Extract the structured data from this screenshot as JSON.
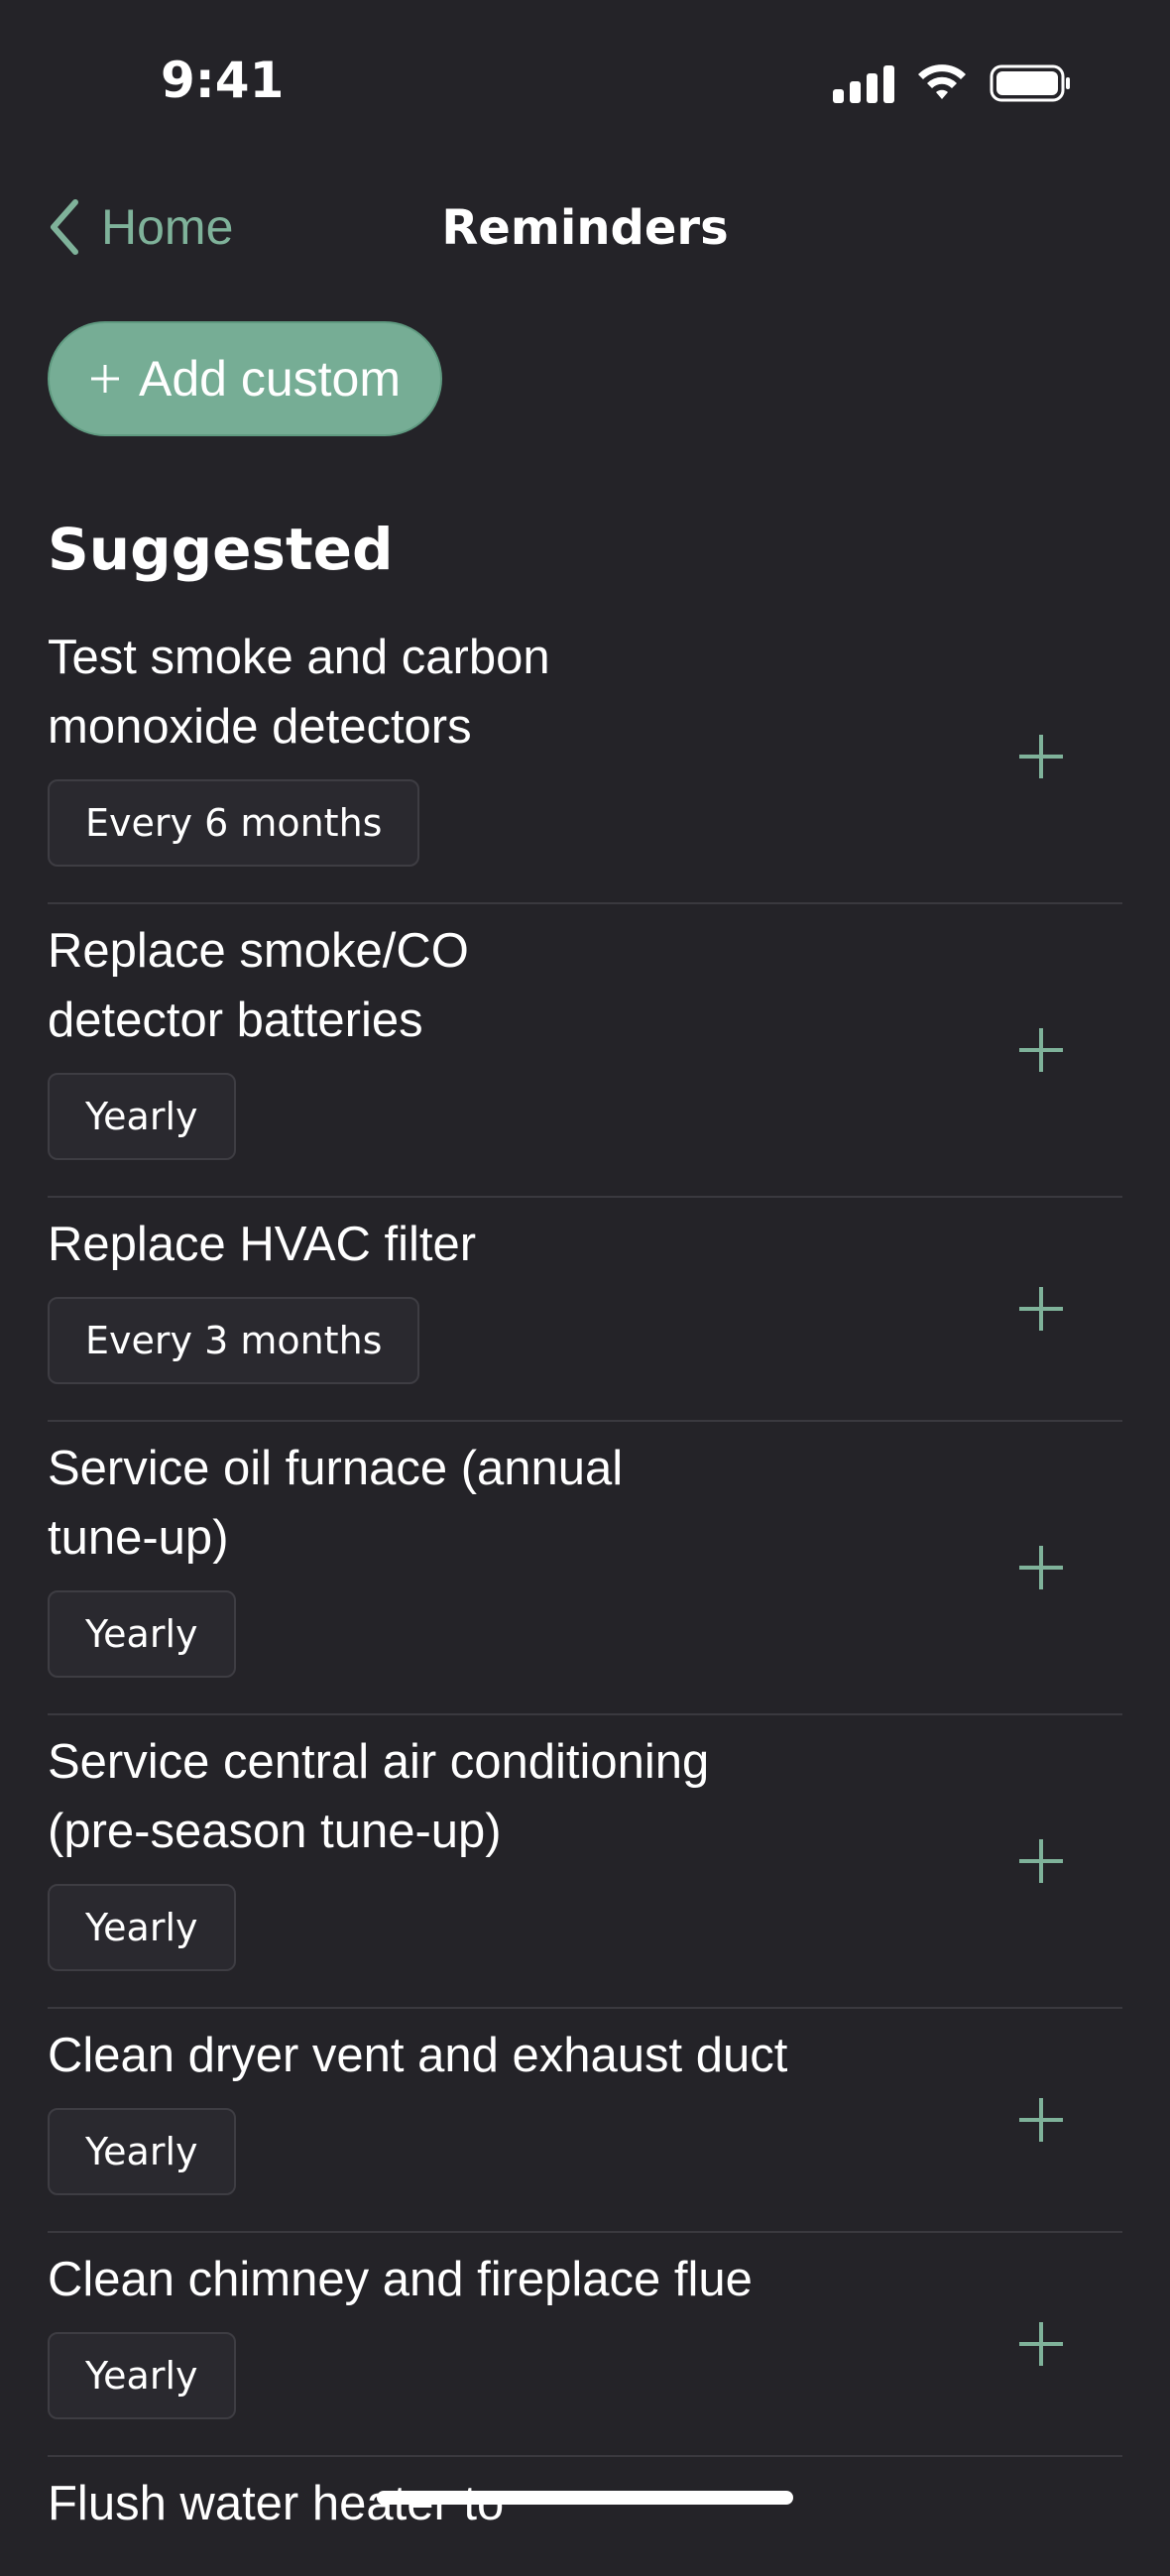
{
  "status_bar": {
    "time": "9:41",
    "icons": [
      "cellular-signal-icon",
      "wifi-icon",
      "battery-icon"
    ]
  },
  "nav": {
    "back_label": "Home",
    "title": "Reminders"
  },
  "add_custom": {
    "label": "Add custom"
  },
  "section": {
    "title": "Suggested"
  },
  "items": [
    {
      "title": "Test smoke and carbon monoxide detectors",
      "frequency": "Every 6 months"
    },
    {
      "title": "Replace smoke/CO detector batteries",
      "frequency": "Yearly"
    },
    {
      "title": "Replace HVAC filter",
      "frequency": "Every 3 months"
    },
    {
      "title": "Service oil furnace (annual tune-up)",
      "frequency": "Yearly"
    },
    {
      "title": "Service central air conditioning (pre-season tune-up)",
      "frequency": "Yearly"
    },
    {
      "title": "Clean dryer vent and exhaust duct",
      "frequency": "Yearly"
    },
    {
      "title": "Clean chimney and fireplace flue",
      "frequency": "Yearly"
    },
    {
      "title": "Flush water heater to",
      "frequency": ""
    }
  ],
  "colors": {
    "background": "#242328",
    "accent": "#7fb29a",
    "button": "#76ad95"
  }
}
